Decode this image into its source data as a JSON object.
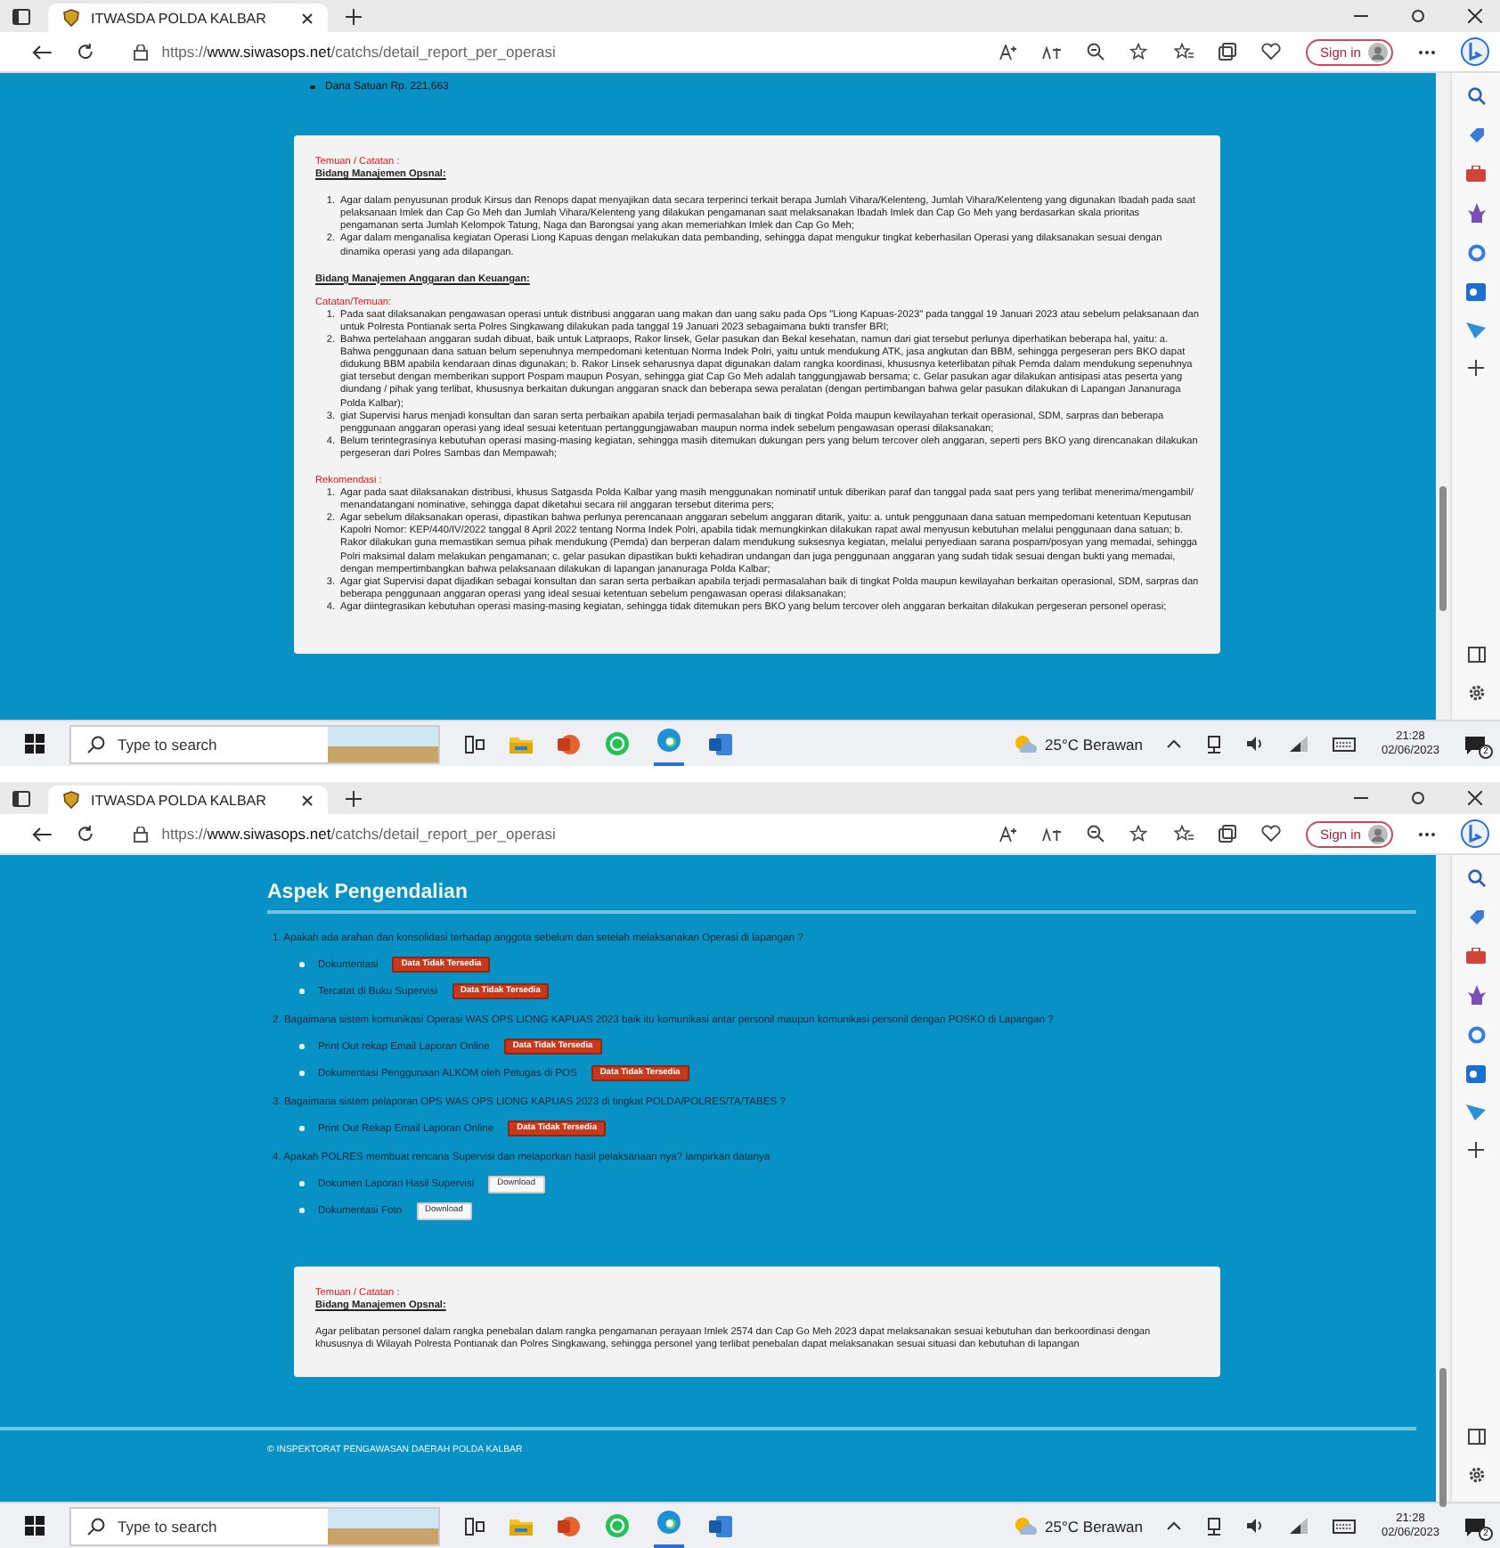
{
  "screens": [
    {
      "browser": {
        "tab_title": "ITWASDA POLDA KALBAR",
        "url": "https://**www.siwasops.net**/catchs/detail_report_per_operasi",
        "sign_in": "Sign in"
      },
      "blocks": [
        {
          "kind": "bullets",
          "items": [
            "Dana Satuan Rp. 221,663"
          ]
        },
        {
          "kind": "card",
          "sections": [
            {
              "kind": "red-label",
              "text": "Temuan / Catatan :"
            },
            {
              "kind": "subtitle",
              "text": "Bidang Manajemen Opsnal:"
            },
            {
              "kind": "list",
              "items": [
                {
                  "number": "1.",
                  "text": "Agar dalam penyusunan produk Kirsus dan Renops dapat menyajikan data secara terperinci terkait berapa Jumlah Vihara/Kelenteng, Jumlah Vihara/Kelenteng yang digunakan Ibadah pada saat pelaksanaan Imlek dan Cap Go Meh dan Jumlah Vihara/Kelenteng yang dilakukan pengamanan saat melaksanakan Ibadah Imlek dan Cap Go Meh yang berdasarkan skala prioritas pengamanan serta Jumlah Kelompok Tatung, Naga dan Barongsai yang akan memeriahkan Imlek dan Cap Go Meh;"
                },
                {
                  "number": "2.",
                  "text": "Agar dalam menganalisa kegiatan Operasi Liong Kapuas dengan melakukan data pembanding, sehingga dapat mengukur tingkat keberhasilan Operasi yang dilaksanakan sesuai dengan dinamika operasi yang ada dilapangan."
                }
              ]
            },
            {
              "kind": "subtitle",
              "text": "Bidang Manajemen Anggaran dan Keuangan:"
            },
            {
              "kind": "red-label",
              "text": "Catatan/Temuan:"
            },
            {
              "kind": "list",
              "items": [
                {
                  "number": "1.",
                  "text": "Pada saat dilaksanakan pengawasan operasi untuk distribusi anggaran uang makan dan uang saku pada Ops \"Liong Kapuas-2023\" pada tanggal 19 Januari 2023 atau sebelum pelaksanaan dan untuk Polresta Pontianak serta Polres Singkawang dilakukan pada tanggal 19 Januari 2023 sebagaimana bukti transfer BRI;"
                },
                {
                  "number": "2.",
                  "text": "Bahwa pertelahaan anggaran sudah dibuat, baik untuk Latpraops, Rakor linsek, Gelar pasukan dan Bekal kesehatan, namun dari giat tersebut perlunya diperhatikan beberapa hal, yaitu: a. Bahwa penggunaan dana satuan belum sepenuhnya mempedomani ketentuan Norma Indek Polri, yaitu untuk mendukung ATK, jasa angkutan dan BBM, sehingga pergeseran pers BKO dapat didukung BBM apabila kendaraan dinas digunakan;   b. Rakor Linsek seharusnya dapat digunakan dalam rangka koordinasi, khususnya keterlibatan pihak Pemda dalam mendukung sepenuhnya giat tersebut dengan memberikan support Pospam maupun Posyan, sehingga giat Cap Go Meh adalah tanggungjawab bersama;  c. Gelar pasukan agar dilakukan antisipasi atas peserta yang diundang / pihak yang terlibat, khususnya berkaitan dukungan anggaran snack dan beberapa sewa peralatan (dengan pertimbangan bahwa gelar pasukan dilakukan di Lapangan Jananuraga Polda Kalbar);"
                },
                {
                  "number": "3.",
                  "text": "giat Supervisi harus menjadi konsultan dan saran serta perbaikan apabila terjadi permasalahan baik di tingkat Polda maupun kewilayahan terkait operasional, SDM, sarpras dan beberapa penggunaan anggaran operasi yang ideal sesuai ketentuan pertanggungjawaban maupun norma indek sebelum pengawasan operasi dilaksanakan;"
                },
                {
                  "number": "4.",
                  "text": "Belum terintegrasinya kebutuhan operasi masing-masing kegiatan, sehingga masih ditemukan dukungan pers yang belum tercover oleh anggaran, seperti pers BKO yang direncanakan dilakukan pergeseran dari Polres Sambas dan Mempawah;"
                }
              ]
            },
            {
              "kind": "red-label",
              "text": "Rekomendasi :"
            },
            {
              "kind": "list",
              "items": [
                {
                  "number": "1.",
                  "text": "Agar pada saat dilaksanakan distribusi, khusus Satgasda Polda Kalbar yang masih menggunakan nominatif untuk diberikan paraf dan tanggal pada saat pers yang terlibat menerima/mengambil/ menandatangani nominative, sehingga dapat diketahui secara riil anggaran tersebut diterima pers;"
                },
                {
                  "number": "2.",
                  "text": "Agar sebelum dilaksanakan operasi, dipastikan bahwa perlunya perencanaan anggaran sebelum anggaran ditarik, yaitu: a. untuk penggunaan dana satuan mempedomani ketentuan Keputusan Kapolri Nomor: KEP/440/IV/2022 tanggal 8 April 2022 tentang Norma Indek Polri, apabila tidak memungkinkan dilakukan rapat awal menyusun kebutuhan melalui penggunaan dana satuan; b. Rakor dilakukan guna memastikan semua pihak mendukung (Pemda) dan berperan dalam mendukung suksesnya kegiatan, melalui penyediaan sarana pospam/posyan yang memadai, sehingga Polri maksimal dalam melakukan pengamanan; c. gelar pasukan dipastikan bukti kehadiran undangan dan juga penggunaan anggaran yang sudah tidak sesuai dengan bukti yang memadai, dengan mempertimbangkan bahwa pelaksanaan dilakukan di lapangan jananuraga Polda Kalbar;"
                },
                {
                  "number": "3.",
                  "text": "Agar giat Supervisi dapat dijadikan sebagai konsultan dan saran serta perbaikan apabila terjadi permasalahan baik di tingkat Polda maupun kewilayahan berkaitan operasional, SDM, sarpras dan beberapa penggunaan anggaran operasi yang ideal sesuai ketentuan sebelum pengawasan operasi dilaksanakan;"
                },
                {
                  "number": "4.",
                  "text": "Agar diintegrasikan kebutuhan operasi masing-masing kegiatan, sehingga tidak ditemukan pers BKO yang belum tercover oleh anggaran berkaitan dilakukan pergeseran personel operasi;"
                }
              ]
            }
          ]
        }
      ],
      "taskbar": {
        "search": {
          "placeholder": "Type to search"
        },
        "weather": "25°C  Berawan",
        "time": "21:28",
        "date": "02/06/2023",
        "notifications": "2"
      }
    },
    {
      "browser": {
        "tab_title": "ITWASDA POLDA KALBAR",
        "url": "https://**www.siwasops.net**/catchs/detail_report_per_operasi",
        "sign_in": "Sign in"
      },
      "blocks": [
        {
          "kind": "heading",
          "text": "Aspek Pengendalian"
        },
        {
          "kind": "questions",
          "items": [
            {
              "text": "1. Apakah ada arahan dan konsolidasi terhadap anggota sebelum dan setelah melaksanakan Operasi di lapangan ?",
              "items": [
                {
                  "label": "Dokumentasi",
                  "action": {
                    "kind": "missing",
                    "text": "Data Tidak Tersedia"
                  }
                },
                {
                  "label": "Tercatat di Buku Supervisi",
                  "action": {
                    "kind": "missing",
                    "text": "Data Tidak Tersedia"
                  }
                }
              ]
            },
            {
              "text": "2. Bagaimana sistem komunikasi Operasi WAS OPS LIONG KAPUAS 2023 baik itu komunikasi antar personil maupun komunikasi personil dengan POSKO di Lapangan ?",
              "items": [
                {
                  "label": "Print Out rekap Email Laporan Online",
                  "action": {
                    "kind": "missing",
                    "text": "Data Tidak Tersedia"
                  }
                },
                {
                  "label": "Dokumentasi Penggunaan ALKOM oleh Petugas di POS",
                  "action": {
                    "kind": "missing",
                    "text": "Data Tidak Tersedia"
                  }
                }
              ]
            },
            {
              "text": "3. Bagaimana sistem pelaporan OPS WAS OPS LIONG KAPUAS 2023 di tingkat POLDA/POLRES/TA/TABES ?",
              "items": [
                {
                  "label": "Print Out Rekap Email Laporan Online",
                  "action": {
                    "kind": "missing",
                    "text": "Data Tidak Tersedia"
                  }
                }
              ]
            },
            {
              "text": "4. Apakah POLRES membuat rencana Supervisi dan melaporkan hasil pelaksanaan nya? lampirkan datanya",
              "items": [
                {
                  "label": "Dokumen Laporan Hasil Supervisi",
                  "action": {
                    "kind": "download",
                    "text": "Download"
                  }
                },
                {
                  "label": "Dokumentasi Foto",
                  "action": {
                    "kind": "download",
                    "text": "Download"
                  }
                }
              ]
            }
          ]
        },
        {
          "kind": "card",
          "sections": [
            {
              "kind": "red-label",
              "text": "Temuan / Catatan :"
            },
            {
              "kind": "subtitle",
              "text": "Bidang Manajemen Opsnal:"
            },
            {
              "kind": "paragraph",
              "text": "Agar pelibatan personel dalam rangka penebalan dalam rangka pengamanan perayaan Imlek 2574 dan Cap Go Meh 2023 dapat melaksanakan sesuai kebutuhan dan berkoordinasi dengan khususnya di Wilayah Polresta Pontianak dan Polres Singkawang, sehingga personel yang terlibat penebalan dapat melaksanakan sesuai situasi dan kebutuhan di lapangan"
            }
          ]
        },
        {
          "kind": "footer",
          "text": "© INSPEKTORAT PENGAWASAN DAERAH POLDA KALBAR"
        }
      ],
      "taskbar": {
        "search": {
          "placeholder": "Type to search"
        },
        "weather": "25°C  Berawan",
        "time": "21:28",
        "date": "02/06/2023",
        "notifications": "2"
      }
    }
  ]
}
